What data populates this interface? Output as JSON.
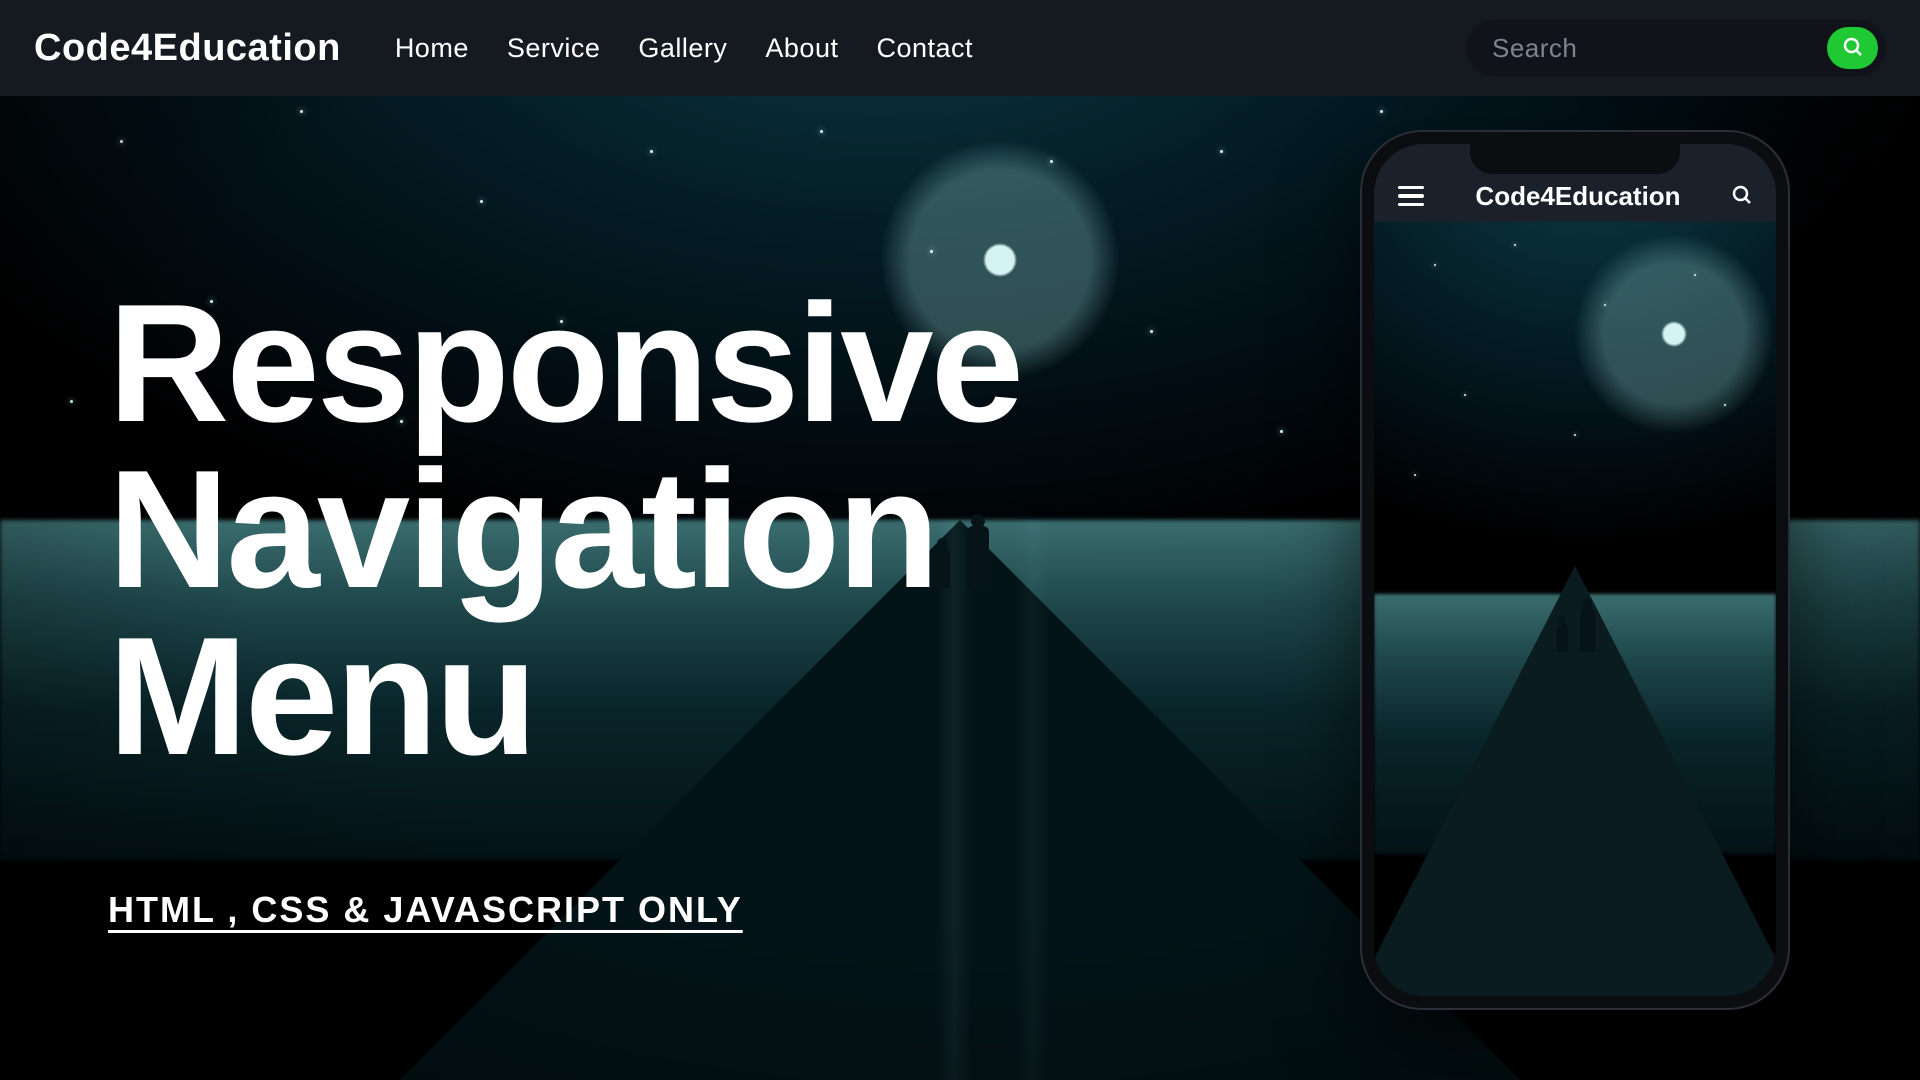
{
  "brand": "Code4Education",
  "nav": {
    "items": [
      {
        "label": "Home"
      },
      {
        "label": "Service"
      },
      {
        "label": "Gallery"
      },
      {
        "label": "About"
      },
      {
        "label": "Contact"
      }
    ]
  },
  "search": {
    "placeholder": "Search",
    "value": ""
  },
  "hero": {
    "title_line1": "Responsive",
    "title_line2": "Navigation",
    "title_line3": "Menu",
    "subtitle": "HTML , CSS & JAVASCRIPT ONLY"
  },
  "phone": {
    "brand": "Code4Education"
  },
  "colors": {
    "navbar_bg": "#151a21",
    "search_bg": "#10141a",
    "accent_green": "#20c933"
  }
}
